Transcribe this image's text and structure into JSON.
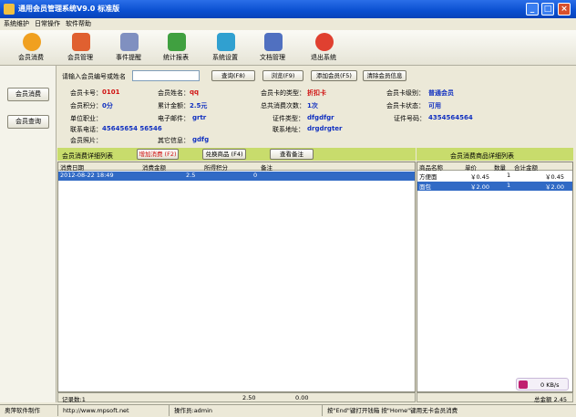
{
  "window": {
    "title": "通用会员管理系统V9.0  标准版"
  },
  "menu": [
    "系统维护",
    "日常操作",
    "软件帮助"
  ],
  "toolbar": [
    {
      "label": "会员消费",
      "icon": "fast-forward-icon",
      "color": "#f0a020"
    },
    {
      "label": "会员管理",
      "icon": "users-icon",
      "color": "#e06030"
    },
    {
      "label": "事件提醒",
      "icon": "notepad-icon",
      "color": "#8090c0"
    },
    {
      "label": "统计报表",
      "icon": "chart-arrow-icon",
      "color": "#40a040"
    },
    {
      "label": "系统设置",
      "icon": "settings-icon",
      "color": "#30a0d0"
    },
    {
      "label": "文档管理",
      "icon": "documents-icon",
      "color": "#5070c0"
    },
    {
      "label": "退出系统",
      "icon": "exit-icon",
      "color": "#e04030"
    }
  ],
  "sidebar": {
    "consume": "会员消费",
    "query": "会员查询"
  },
  "search": {
    "label": "请输入会员编号或姓名",
    "value": "",
    "query_btn": "查询(F8)",
    "browse_btn": "浏览(F9)",
    "add_btn": "添加会员(F5)",
    "clear_btn": "清除会员信息"
  },
  "member": {
    "id_label": "会员卡号：",
    "id": "0101",
    "name_label": "会员姓名：",
    "name": "qq",
    "card_type_label": "会员卡的类型：",
    "card_type": "折扣卡",
    "level_label": "会员卡级别：",
    "level": "普通会员",
    "points_label": "会员积分：",
    "points": "0分",
    "total_label": "累计金额：",
    "total": "2.5元",
    "times_label": "总共消费次数：",
    "times": "1次",
    "status_label": "会员卡状态：",
    "status": "可用",
    "job_label": "单位职业：",
    "job": "",
    "email_label": "电子邮件：",
    "email": "grtr",
    "cert_type_label": "证件类型：",
    "cert_type": "dfgdfgr",
    "cert_no_label": "证件号码：",
    "cert_no": "4354564564",
    "phone_label": "联系电话：",
    "phone": "45645654 56546",
    "address_label": "联系地址：",
    "address": "drgdrgter",
    "photo_label": "会员照片：",
    "other_label": "其它信息：",
    "other": "gdfg"
  },
  "consume_bar": {
    "title": "会员消费详细列表",
    "add_btn": "增加消费 (F2)",
    "exchange_btn": "兑换商品 (F4)",
    "note_btn": "查看备注",
    "right_title": "会员消费商品详细列表"
  },
  "consume_table": {
    "headers": [
      "消费日期",
      "消费金额",
      "所得积分",
      "备注"
    ],
    "rows": [
      {
        "date": "2012-08-22 18:49",
        "amount": "2.5",
        "points": "0",
        "note": ""
      }
    ]
  },
  "goods_table": {
    "headers": [
      "商品名称",
      "单价",
      "数量",
      "合计金额"
    ],
    "rows": [
      {
        "name": "方便面",
        "price": "￥0.45",
        "qty": "1",
        "sum": "￥0.45"
      },
      {
        "name": "面包",
        "price": "￥2.00",
        "qty": "1",
        "sum": "￥2.00"
      }
    ]
  },
  "footer_left": {
    "count": "记录数:1",
    "amount": "2.50",
    "points": "0.00"
  },
  "footer_right": {
    "total": "总金额 2.45"
  },
  "net": {
    "speed": "0 KB/s"
  },
  "status": {
    "maker": "奥萍软件制作",
    "url": "http://www.mpsoft.net",
    "operator": "操作员:admin",
    "hint": "按\"End\"键打开钱箱 按\"Home\"键用无卡会员消费"
  }
}
